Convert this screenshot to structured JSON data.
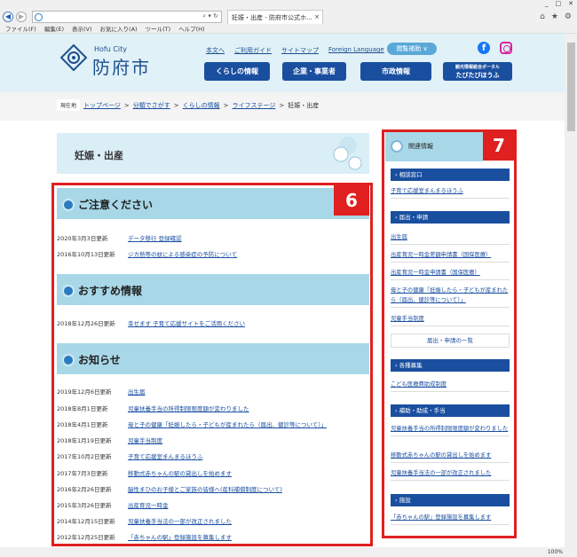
{
  "browser": {
    "tab_title": "妊娠・出産 - 防府市公式ホ...",
    "menu": [
      "ファイル(F)",
      "編集(E)",
      "表示(V)",
      "お気に入り(A)",
      "ツール(T)",
      "ヘルプ(H)"
    ],
    "zoom": "100%"
  },
  "header": {
    "city_en": "Hofu City",
    "city_jp": "防府市",
    "links": [
      "本文へ",
      "ご利用ガイド",
      "サイトマップ",
      "Foreign Language"
    ],
    "access_label": "閲覧補助 ∨",
    "nav": [
      "くらしの情報",
      "企業・事業者",
      "市政情報"
    ],
    "tourism_line1": "観光情報総合ポータル",
    "tourism_line2": "たびたびほうふ"
  },
  "breadcrumb": {
    "current_label": "現在地",
    "items": [
      "トップページ",
      "分類でさがす",
      "くらしの情報",
      "ライフステージ"
    ],
    "separator": ">",
    "current": "妊娠・出産"
  },
  "page_title": "妊娠・出産",
  "sections": [
    {
      "title": "ご注意ください",
      "rows": [
        {
          "date": "2020年3月3日更新",
          "link": "データ移行 登録確認"
        },
        {
          "date": "2016年10月13日更新",
          "link": "ジカ熱等の蚊による感染症の予防について"
        }
      ]
    },
    {
      "title": "おすすめ情報",
      "rows": [
        {
          "date": "2018年12月26日更新",
          "link": "幸せます 子育て応援サイトをご活用ください"
        }
      ]
    },
    {
      "title": "お知らせ",
      "rows": [
        {
          "date": "2019年12月6日更新",
          "link": "出生届"
        },
        {
          "date": "2018年8月1日更新",
          "link": "児童扶養手当の所得制限限度額が変わりました"
        },
        {
          "date": "2018年4月1日更新",
          "link": "母と子の健康「妊娠したら・子どもが産まれたら（届出、健診等について）」"
        },
        {
          "date": "2018年1月19日更新",
          "link": "児童手当制度"
        },
        {
          "date": "2017年10月2日更新",
          "link": "子育て応援室まんまるほうふ"
        },
        {
          "date": "2017年7月3日更新",
          "link": "移動式赤ちゃんの駅の貸出しを始めます"
        },
        {
          "date": "2016年2月26日更新",
          "link": "脳性まひのお子様とご家族の皆様へ(産科補償制度について)"
        },
        {
          "date": "2015年3月26日更新",
          "link": "出産育児一時金"
        },
        {
          "date": "2014年12月15日更新",
          "link": "児童扶養手当法の一部が改正されました"
        },
        {
          "date": "2012年12月25日更新",
          "link": "「赤ちゃんの駅」登録施設を募集します"
        }
      ]
    }
  ],
  "sidebar": {
    "title": "関連情報",
    "categories": [
      {
        "label": "相談窓口",
        "links": [
          "子育て応援室まんまるほうふ"
        ]
      },
      {
        "label": "届出・申請",
        "links": [
          "出生届",
          "出産育児一時金差額申請書（国保医療）",
          "出産育児一時金申請書（国保医療）",
          "母と子の健康「妊娠したら・子どもが産まれたら（届出、健診等について）」",
          "児童手当制度"
        ],
        "button": "届出・申請の一覧"
      },
      {
        "label": "各種募集",
        "links": [
          "こども医療費助成制度"
        ]
      },
      {
        "label": "補助・助成・手当",
        "links": [
          "児童扶養手当の所得制限限度額が変わりました",
          "移動式赤ちゃんの駅の貸出しを始めます",
          "児童扶養手当法の一部が改正されました"
        ]
      },
      {
        "label": "施設",
        "links": [
          "「赤ちゃんの駅」登録施設を募集します"
        ]
      }
    ]
  },
  "annotations": {
    "main_label": "6",
    "side_label": "7"
  },
  "colors": {
    "accent": "#1a4fa0",
    "red": "#e02020",
    "header_bg": "#e0f1f7",
    "section_bg": "#a8d8e8"
  }
}
